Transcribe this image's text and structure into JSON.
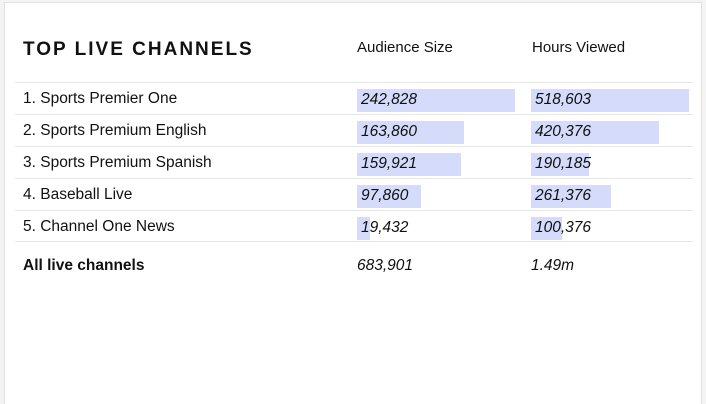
{
  "table": {
    "title": "TOP LIVE CHANNELS",
    "columns": {
      "audience": "Audience Size",
      "hours": "Hours Viewed"
    },
    "bar_color": "#d5dcfb",
    "audience_max": 242828,
    "hours_max": 518603,
    "rows": [
      {
        "name": "1. Sports Premier One",
        "audience": "242,828",
        "audience_value": 242828,
        "hours": "518,603",
        "hours_value": 518603
      },
      {
        "name": "2. Sports Premium English",
        "audience": "163,860",
        "audience_value": 163860,
        "hours": "420,376",
        "hours_value": 420376
      },
      {
        "name": "3. Sports Premium Spanish",
        "audience": "159,921",
        "audience_value": 159921,
        "hours": "190,185",
        "hours_value": 190185
      },
      {
        "name": "4. Baseball Live",
        "audience": "97,860",
        "audience_value": 97860,
        "hours": "261,376",
        "hours_value": 261376
      },
      {
        "name": "5. Channel One News",
        "audience": "19,432",
        "audience_value": 19432,
        "hours": "100,376",
        "hours_value": 100376
      }
    ],
    "total": {
      "label": "All live channels",
      "audience": "683,901",
      "hours": "1.49m"
    }
  }
}
